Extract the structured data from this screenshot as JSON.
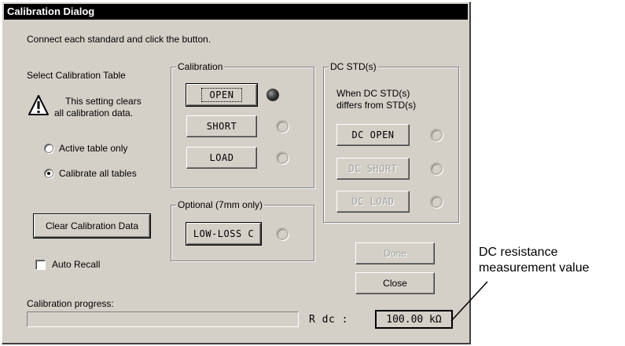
{
  "dialog": {
    "title": "Calibration Dialog",
    "instruction": "Connect each standard and click the button."
  },
  "table_select": {
    "heading": "Select Calibration Table",
    "warning_line1": "This setting clears",
    "warning_line2": "all calibration data.",
    "options": [
      {
        "label": "Active table only",
        "selected": false
      },
      {
        "label": "Calibrate all tables",
        "selected": true
      }
    ]
  },
  "calibration": {
    "group_label": "Calibration",
    "buttons": [
      {
        "label": "OPEN",
        "done": true
      },
      {
        "label": "SHORT",
        "done": false
      },
      {
        "label": "LOAD",
        "done": false
      }
    ]
  },
  "optional": {
    "group_label": "Optional (7mm only)",
    "button_label": "LOW-LOSS C"
  },
  "dc_std": {
    "group_label": "DC STD(s)",
    "note_line1": "When DC STD(s)",
    "note_line2": "differs from STD(s)",
    "buttons": [
      {
        "label": "DC OPEN",
        "enabled": true
      },
      {
        "label": "DC SHORT",
        "enabled": false
      },
      {
        "label": "DC LOAD",
        "enabled": false
      }
    ]
  },
  "actions": {
    "clear_label": "Clear Calibration Data",
    "auto_recall_label": "Auto Recall",
    "auto_recall_checked": false,
    "done_label": "Done",
    "close_label": "Close"
  },
  "progress": {
    "label": "Calibration progress:",
    "value": 0
  },
  "rdc": {
    "label": "R dc :",
    "value": "100.00 kΩ"
  },
  "annotation": {
    "line1": "DC resistance",
    "line2": "measurement value"
  }
}
